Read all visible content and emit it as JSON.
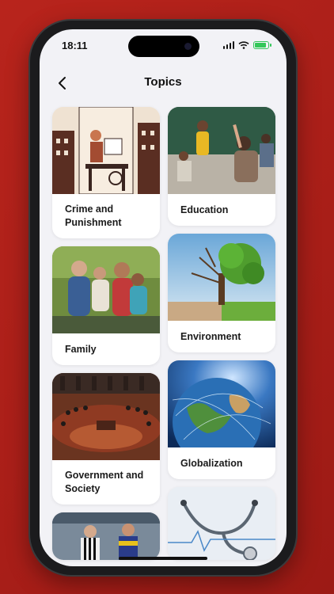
{
  "status_bar": {
    "time": "18:11"
  },
  "header": {
    "title": "Topics",
    "back_icon": "chevron-left-icon"
  },
  "topics": [
    {
      "label_line1": "Crime and",
      "label_line2": "Punishment"
    },
    {
      "label_line1": "Education",
      "label_line2": ""
    },
    {
      "label_line1": "Family",
      "label_line2": ""
    },
    {
      "label_line1": "Environment",
      "label_line2": ""
    },
    {
      "label_line1": "Government and",
      "label_line2": "Society"
    },
    {
      "label_line1": "Globalization",
      "label_line2": ""
    },
    {
      "label_line1": "",
      "label_line2": ""
    },
    {
      "label_line1": "",
      "label_line2": ""
    }
  ],
  "colors": {
    "background": "#b8241c",
    "screen": "#f2f2f6",
    "card": "#ffffff",
    "battery": "#34c759"
  }
}
